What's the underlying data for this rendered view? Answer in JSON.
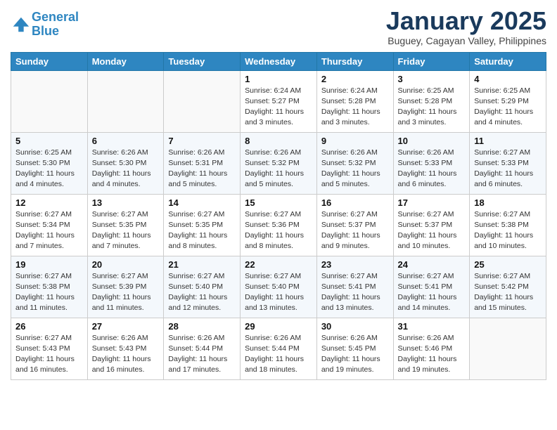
{
  "header": {
    "logo_line1": "General",
    "logo_line2": "Blue",
    "month_title": "January 2025",
    "location": "Buguey, Cagayan Valley, Philippines"
  },
  "weekdays": [
    "Sunday",
    "Monday",
    "Tuesday",
    "Wednesday",
    "Thursday",
    "Friday",
    "Saturday"
  ],
  "weeks": [
    [
      {
        "day": "",
        "info": ""
      },
      {
        "day": "",
        "info": ""
      },
      {
        "day": "",
        "info": ""
      },
      {
        "day": "1",
        "info": "Sunrise: 6:24 AM\nSunset: 5:27 PM\nDaylight: 11 hours and 3 minutes."
      },
      {
        "day": "2",
        "info": "Sunrise: 6:24 AM\nSunset: 5:28 PM\nDaylight: 11 hours and 3 minutes."
      },
      {
        "day": "3",
        "info": "Sunrise: 6:25 AM\nSunset: 5:28 PM\nDaylight: 11 hours and 3 minutes."
      },
      {
        "day": "4",
        "info": "Sunrise: 6:25 AM\nSunset: 5:29 PM\nDaylight: 11 hours and 4 minutes."
      }
    ],
    [
      {
        "day": "5",
        "info": "Sunrise: 6:25 AM\nSunset: 5:30 PM\nDaylight: 11 hours and 4 minutes."
      },
      {
        "day": "6",
        "info": "Sunrise: 6:26 AM\nSunset: 5:30 PM\nDaylight: 11 hours and 4 minutes."
      },
      {
        "day": "7",
        "info": "Sunrise: 6:26 AM\nSunset: 5:31 PM\nDaylight: 11 hours and 5 minutes."
      },
      {
        "day": "8",
        "info": "Sunrise: 6:26 AM\nSunset: 5:32 PM\nDaylight: 11 hours and 5 minutes."
      },
      {
        "day": "9",
        "info": "Sunrise: 6:26 AM\nSunset: 5:32 PM\nDaylight: 11 hours and 5 minutes."
      },
      {
        "day": "10",
        "info": "Sunrise: 6:26 AM\nSunset: 5:33 PM\nDaylight: 11 hours and 6 minutes."
      },
      {
        "day": "11",
        "info": "Sunrise: 6:27 AM\nSunset: 5:33 PM\nDaylight: 11 hours and 6 minutes."
      }
    ],
    [
      {
        "day": "12",
        "info": "Sunrise: 6:27 AM\nSunset: 5:34 PM\nDaylight: 11 hours and 7 minutes."
      },
      {
        "day": "13",
        "info": "Sunrise: 6:27 AM\nSunset: 5:35 PM\nDaylight: 11 hours and 7 minutes."
      },
      {
        "day": "14",
        "info": "Sunrise: 6:27 AM\nSunset: 5:35 PM\nDaylight: 11 hours and 8 minutes."
      },
      {
        "day": "15",
        "info": "Sunrise: 6:27 AM\nSunset: 5:36 PM\nDaylight: 11 hours and 8 minutes."
      },
      {
        "day": "16",
        "info": "Sunrise: 6:27 AM\nSunset: 5:37 PM\nDaylight: 11 hours and 9 minutes."
      },
      {
        "day": "17",
        "info": "Sunrise: 6:27 AM\nSunset: 5:37 PM\nDaylight: 11 hours and 10 minutes."
      },
      {
        "day": "18",
        "info": "Sunrise: 6:27 AM\nSunset: 5:38 PM\nDaylight: 11 hours and 10 minutes."
      }
    ],
    [
      {
        "day": "19",
        "info": "Sunrise: 6:27 AM\nSunset: 5:38 PM\nDaylight: 11 hours and 11 minutes."
      },
      {
        "day": "20",
        "info": "Sunrise: 6:27 AM\nSunset: 5:39 PM\nDaylight: 11 hours and 11 minutes."
      },
      {
        "day": "21",
        "info": "Sunrise: 6:27 AM\nSunset: 5:40 PM\nDaylight: 11 hours and 12 minutes."
      },
      {
        "day": "22",
        "info": "Sunrise: 6:27 AM\nSunset: 5:40 PM\nDaylight: 11 hours and 13 minutes."
      },
      {
        "day": "23",
        "info": "Sunrise: 6:27 AM\nSunset: 5:41 PM\nDaylight: 11 hours and 13 minutes."
      },
      {
        "day": "24",
        "info": "Sunrise: 6:27 AM\nSunset: 5:41 PM\nDaylight: 11 hours and 14 minutes."
      },
      {
        "day": "25",
        "info": "Sunrise: 6:27 AM\nSunset: 5:42 PM\nDaylight: 11 hours and 15 minutes."
      }
    ],
    [
      {
        "day": "26",
        "info": "Sunrise: 6:27 AM\nSunset: 5:43 PM\nDaylight: 11 hours and 16 minutes."
      },
      {
        "day": "27",
        "info": "Sunrise: 6:26 AM\nSunset: 5:43 PM\nDaylight: 11 hours and 16 minutes."
      },
      {
        "day": "28",
        "info": "Sunrise: 6:26 AM\nSunset: 5:44 PM\nDaylight: 11 hours and 17 minutes."
      },
      {
        "day": "29",
        "info": "Sunrise: 6:26 AM\nSunset: 5:44 PM\nDaylight: 11 hours and 18 minutes."
      },
      {
        "day": "30",
        "info": "Sunrise: 6:26 AM\nSunset: 5:45 PM\nDaylight: 11 hours and 19 minutes."
      },
      {
        "day": "31",
        "info": "Sunrise: 6:26 AM\nSunset: 5:46 PM\nDaylight: 11 hours and 19 minutes."
      },
      {
        "day": "",
        "info": ""
      }
    ]
  ]
}
